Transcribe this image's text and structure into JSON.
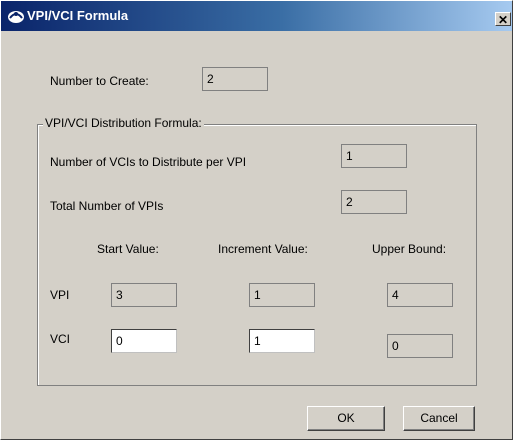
{
  "window": {
    "title": "VPI/VCI Formula",
    "close_glyph": "✕"
  },
  "number_to_create": {
    "label": "Number to Create:",
    "value": "2"
  },
  "distribution": {
    "legend": "VPI/VCI Distribution Formula:",
    "vcis_per_vpi": {
      "label": "Number of VCIs to Distribute per VPI",
      "value": "1"
    },
    "total_vpis": {
      "label": "Total Number of VPIs",
      "value": "2"
    },
    "columns": {
      "start": "Start Value:",
      "increment": "Increment Value:",
      "upper": "Upper Bound:"
    },
    "vpi": {
      "label": "VPI",
      "start": "3",
      "increment": "1",
      "upper": "4"
    },
    "vci": {
      "label": "VCI",
      "start": "0",
      "increment": "1",
      "upper": "0"
    }
  },
  "buttons": {
    "ok": "OK",
    "cancel": "Cancel"
  },
  "icons": {
    "title_icon": "network-cloud-icon",
    "close": "close-icon"
  },
  "colors": {
    "titlebar": "#0a246a",
    "face": "#d4d0c8"
  }
}
